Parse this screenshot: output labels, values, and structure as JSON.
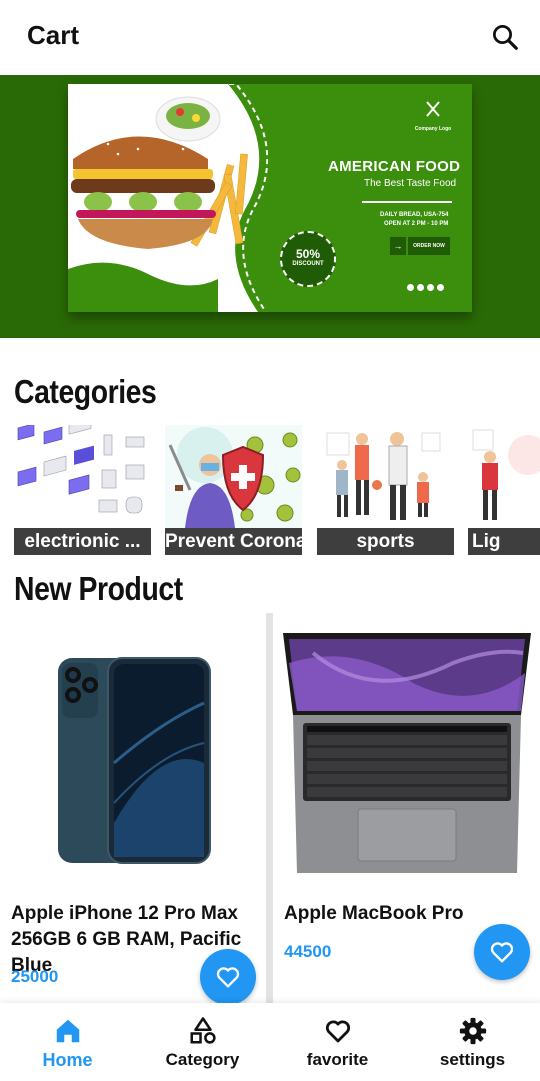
{
  "appbar": {
    "title": "Cart",
    "search_icon": "search-icon"
  },
  "banner": {
    "headline": "AMERICAN FOOD",
    "subline": "The Best Taste Food",
    "address_line1": "DAILY BREAD, USA-754",
    "address_line2": "OPEN AT 2 PM - 10 PM",
    "cta": "ORDER NOW",
    "discount_pct": "50%",
    "discount_label": "DISCOUNT",
    "logo_text": "Company Logo",
    "colors": {
      "outer": "#2a6a06",
      "card": "#3b8f0d",
      "dark": "#1f5c05"
    }
  },
  "categories": {
    "title": "Categories",
    "items": [
      {
        "label": "electrionic ..."
      },
      {
        "label": "Prevent Corona"
      },
      {
        "label": "sports"
      },
      {
        "label": "Lig"
      }
    ]
  },
  "new_product": {
    "title": "New Product",
    "items": [
      {
        "name": "Apple iPhone 12 Pro Max 256GB 6 GB RAM, Pacific Blue",
        "price": "25000"
      },
      {
        "name": "Apple MacBook Pro",
        "price": "44500"
      }
    ]
  },
  "bottom_nav": {
    "items": [
      {
        "label": "Home",
        "icon": "home-icon",
        "active": true
      },
      {
        "label": "Category",
        "icon": "shapes-icon",
        "active": false
      },
      {
        "label": "favorite",
        "icon": "heart-icon",
        "active": false
      },
      {
        "label": "settings",
        "icon": "gear-icon",
        "active": false
      }
    ]
  },
  "colors": {
    "accent": "#2196f3"
  }
}
